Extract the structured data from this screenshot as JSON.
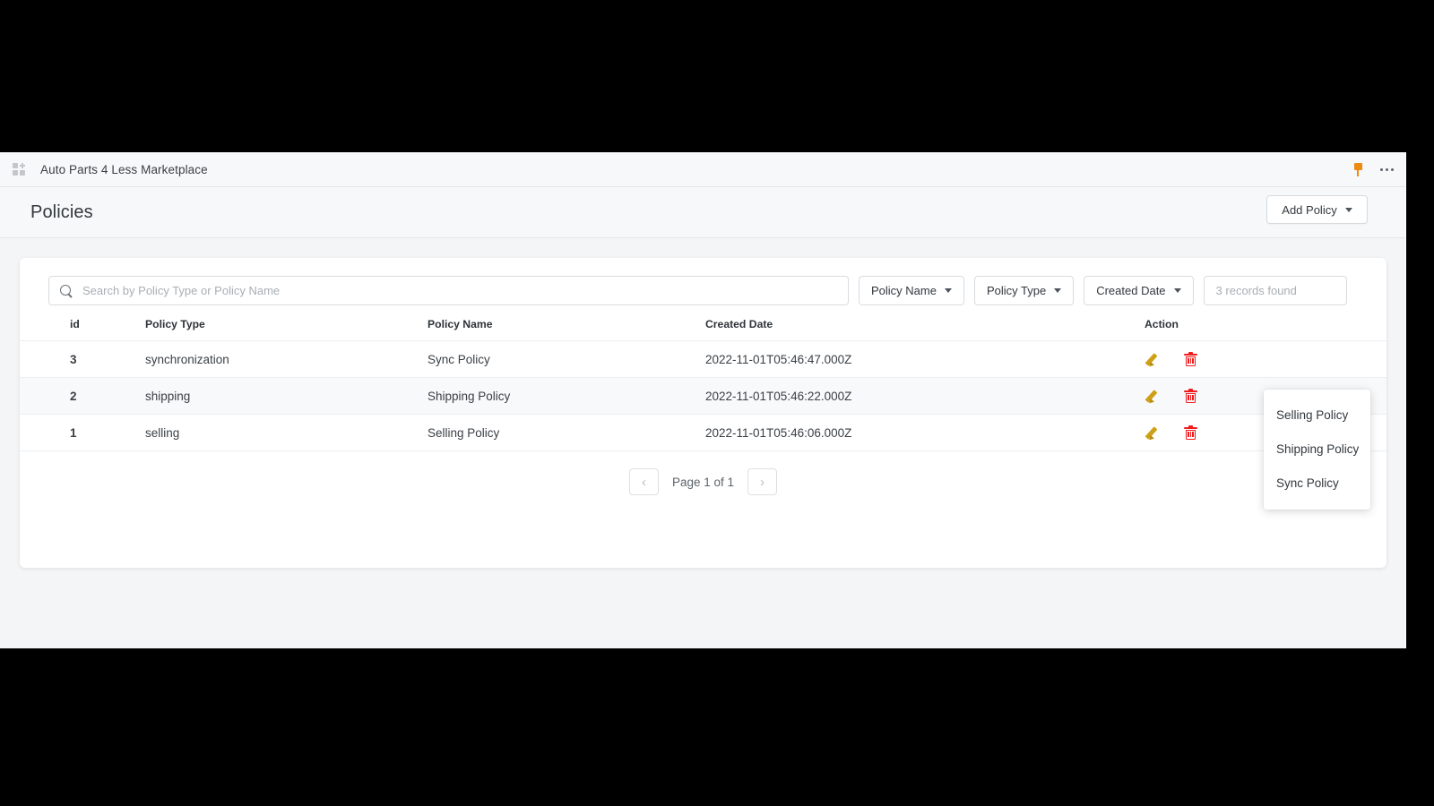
{
  "app_bar": {
    "grid_icon": "apps-grid-icon",
    "title": "Auto Parts 4 Less Marketplace",
    "pin_icon": "pin-icon",
    "more_icon": "more-options-icon"
  },
  "page_header": {
    "title": "Policies",
    "add_policy_label": "Add Policy"
  },
  "add_policy_menu": {
    "items": [
      {
        "label": "Selling Policy"
      },
      {
        "label": "Shipping Policy"
      },
      {
        "label": "Sync Policy"
      }
    ]
  },
  "toolbar": {
    "search_placeholder": "Search by Policy Type or Policy Name",
    "search_value": "",
    "search_icon": "search-icon",
    "filters": [
      {
        "label": "Policy Name"
      },
      {
        "label": "Policy Type"
      },
      {
        "label": "Created Date"
      }
    ],
    "records_found": "3 records found"
  },
  "table": {
    "columns": [
      "id",
      "Policy Type",
      "Policy Name",
      "Created Date",
      "Action"
    ],
    "rows": [
      {
        "id": "3",
        "policy_type": "synchronization",
        "policy_name": "Sync Policy",
        "created_date": "2022-11-01T05:46:47.000Z"
      },
      {
        "id": "2",
        "policy_type": "shipping",
        "policy_name": "Shipping Policy",
        "created_date": "2022-11-01T05:46:22.000Z"
      },
      {
        "id": "1",
        "policy_type": "selling",
        "policy_name": "Selling Policy",
        "created_date": "2022-11-01T05:46:06.000Z"
      }
    ]
  },
  "pagination": {
    "prev_label": "‹",
    "page_label": "Page 1 of 1",
    "next_label": "›"
  },
  "colors": {
    "accent_pin": "#ee8b10",
    "edit_icon": "#cfa017",
    "delete_icon": "#f01c1c",
    "page_background": "#f4f5f7",
    "card_background": "#ffffff"
  }
}
